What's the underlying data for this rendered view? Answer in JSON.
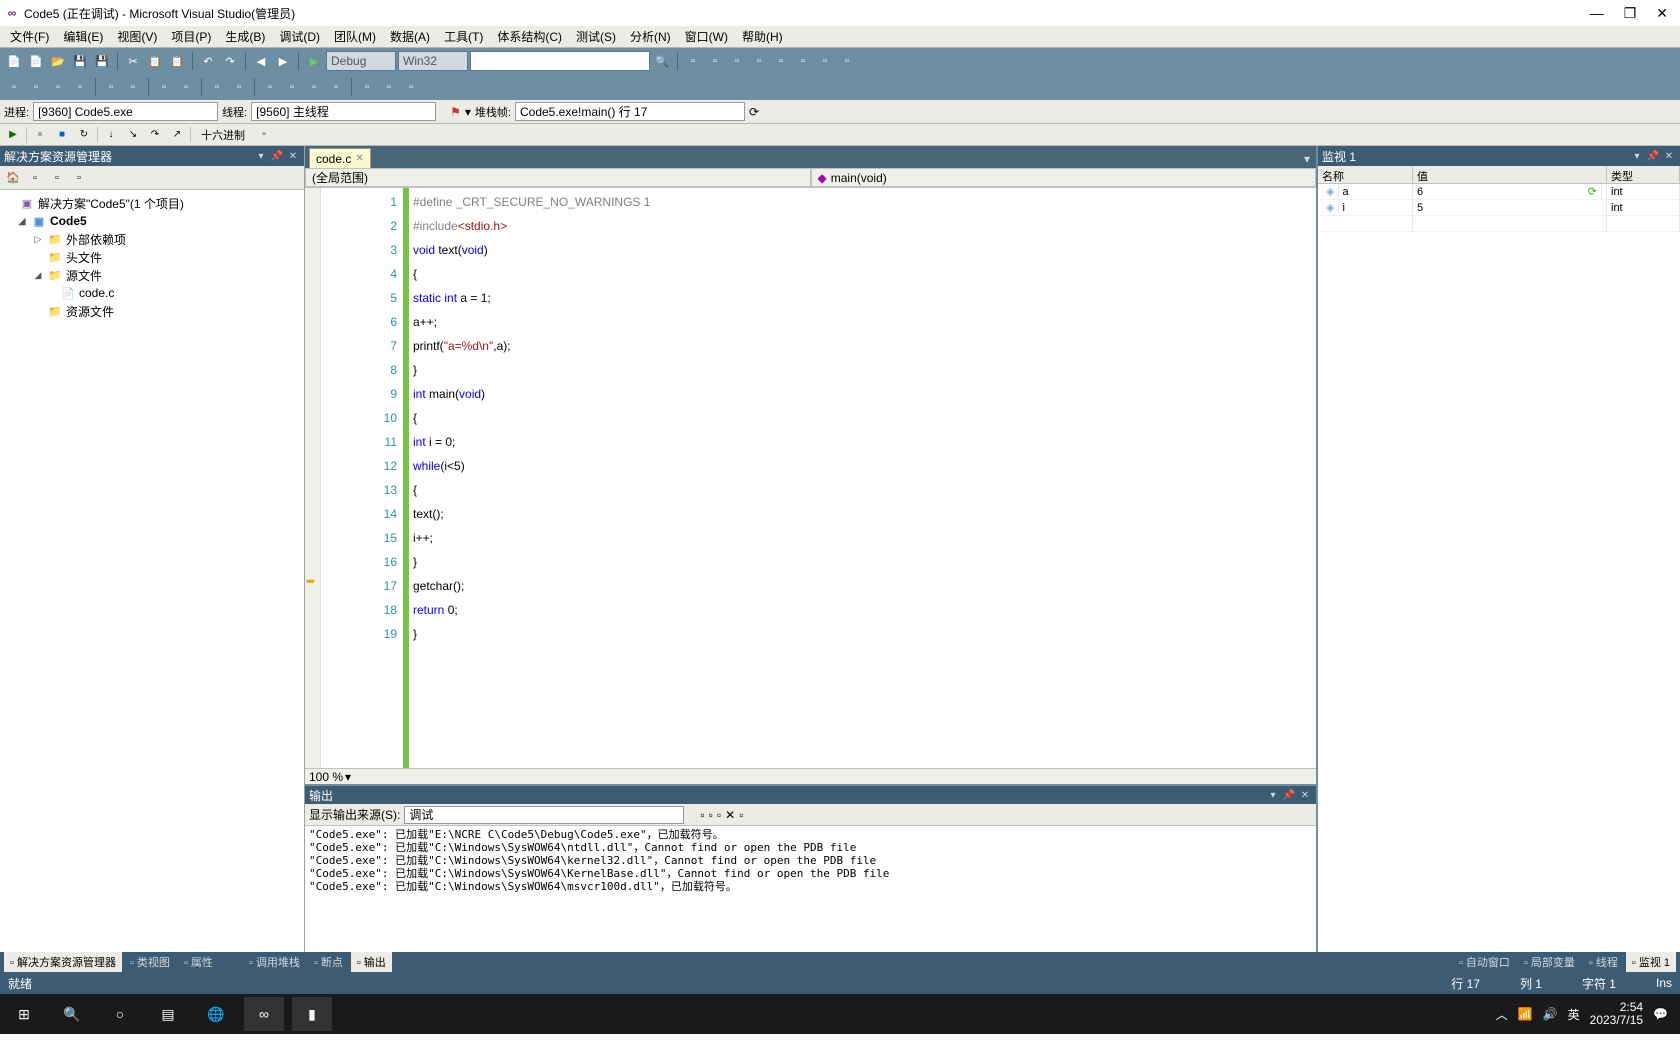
{
  "title": "Code5 (正在调试) - Microsoft Visual Studio(管理员)",
  "menu": [
    "文件(F)",
    "编辑(E)",
    "视图(V)",
    "项目(P)",
    "生成(B)",
    "调试(D)",
    "团队(M)",
    "数据(A)",
    "工具(T)",
    "体系结构(C)",
    "测试(S)",
    "分析(N)",
    "窗口(W)",
    "帮助(H)"
  ],
  "tb": {
    "config": "Debug",
    "platform": "Win32"
  },
  "debug": {
    "process_label": "进程:",
    "process": "[9360] Code5.exe",
    "thread_label": "线程:",
    "thread": "[9560] 主线程",
    "frame_label": "堆栈帧:",
    "frame": "Code5.exe!main() 行 17",
    "hex": "十六进制"
  },
  "solution": {
    "title": "解决方案资源管理器",
    "root": "解决方案\"Code5\"(1 个项目)",
    "project": "Code5",
    "folders": [
      "外部依赖项",
      "头文件",
      "源文件",
      "资源文件"
    ],
    "file": "code.c"
  },
  "editor": {
    "tab": "code.c",
    "scope": "(全局范围)",
    "func": "main(void)",
    "zoom": "100 %",
    "current_line": 17,
    "lines": [
      {
        "n": 1,
        "h": "<span class='pp'>#define _CRT_SECURE_NO_WARNINGS 1</span>"
      },
      {
        "n": 2,
        "h": "<span class='pp'>#include</span><span class='hdr'>&lt;stdio.h&gt;</span>"
      },
      {
        "n": 3,
        "h": "<span class='kw'>void</span> text(<span class='kw'>void</span>)"
      },
      {
        "n": 4,
        "h": "{"
      },
      {
        "n": 5,
        "h": "<span class='kw'>static</span> <span class='kw'>int</span> a = 1;"
      },
      {
        "n": 6,
        "h": "a++;"
      },
      {
        "n": 7,
        "h": "printf(<span class='str'>\"a=%d\\n\"</span>,a);"
      },
      {
        "n": 8,
        "h": "}"
      },
      {
        "n": 9,
        "h": "<span class='kw'>int</span> main(<span class='kw'>void</span>)"
      },
      {
        "n": 10,
        "h": "{"
      },
      {
        "n": 11,
        "h": "<span class='kw'>int</span> i = 0;"
      },
      {
        "n": 12,
        "h": "<span class='kw'>while</span>(i&lt;5)"
      },
      {
        "n": 13,
        "h": "{"
      },
      {
        "n": 14,
        "h": "text();"
      },
      {
        "n": 15,
        "h": "i++;"
      },
      {
        "n": 16,
        "h": "}"
      },
      {
        "n": 17,
        "h": "getchar();"
      },
      {
        "n": 18,
        "h": "<span class='kw'>return</span> 0;"
      },
      {
        "n": 19,
        "h": "}"
      }
    ]
  },
  "watch": {
    "title": "监视 1",
    "cols": [
      "名称",
      "值",
      "类型"
    ],
    "rows": [
      {
        "name": "a",
        "value": "6",
        "type": "int",
        "refresh": true
      },
      {
        "name": "i",
        "value": "5",
        "type": "int",
        "refresh": false
      }
    ]
  },
  "output": {
    "title": "输出",
    "source_label": "显示输出来源(S):",
    "source": "调试",
    "lines": [
      "\"Code5.exe\": 已加载\"E:\\NCRE C\\Code5\\Debug\\Code5.exe\"，已加载符号。",
      "\"Code5.exe\": 已加载\"C:\\Windows\\SysWOW64\\ntdll.dll\"，Cannot find or open the PDB file",
      "\"Code5.exe\": 已加载\"C:\\Windows\\SysWOW64\\kernel32.dll\"，Cannot find or open the PDB file",
      "\"Code5.exe\": 已加载\"C:\\Windows\\SysWOW64\\KernelBase.dll\"，Cannot find or open the PDB file",
      "\"Code5.exe\": 已加载\"C:\\Windows\\SysWOW64\\msvcr100d.dll\"，已加载符号。"
    ]
  },
  "btabs_left": [
    "解决方案资源管理器",
    "类视图",
    "属性"
  ],
  "btabs_center": [
    "调用堆栈",
    "断点",
    "输出"
  ],
  "btabs_right": [
    "自动窗口",
    "局部变量",
    "线程",
    "监视 1"
  ],
  "status": {
    "ready": "就绪",
    "line": "行 17",
    "col": "列 1",
    "ch": "字符 1",
    "ins": "Ins"
  },
  "tray": {
    "ime": "英",
    "time": "2:54",
    "date": "2023/7/15"
  }
}
